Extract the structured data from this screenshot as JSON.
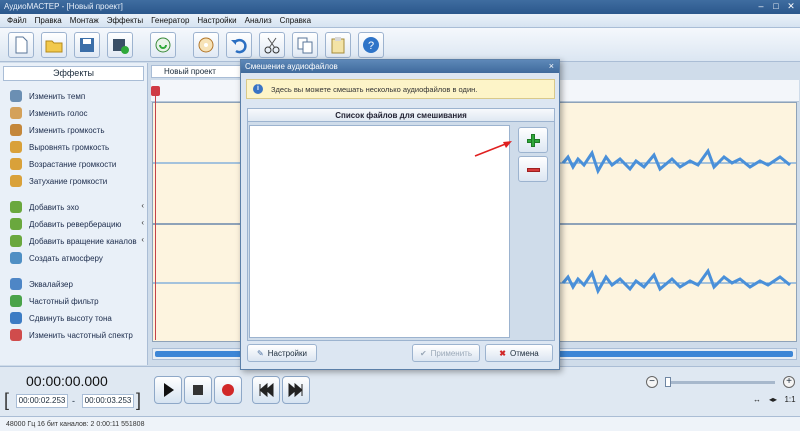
{
  "window": {
    "title": "АудиоМАСТЕР - [Новый проект]"
  },
  "menu": [
    "Файл",
    "Правка",
    "Монтаж",
    "Эффекты",
    "Генератор",
    "Настройки",
    "Анализ",
    "Справка"
  ],
  "toolbar_icons": [
    "new-file-icon",
    "open-folder-icon",
    "save-icon",
    "add-video-icon",
    "record-icon",
    "audio-cd-icon",
    "undo-icon",
    "cut-icon",
    "copy-icon",
    "paste-icon",
    "help-icon"
  ],
  "effects": {
    "title": "Эффекты",
    "items": [
      "Изменить темп",
      "Изменить голос",
      "Изменить громкость",
      "Выровнять громкость",
      "Возрастание громкости",
      "Затухание громкости",
      "Добавить эхо",
      "Добавить реверберацию",
      "Добавить вращение каналов",
      "Создать атмосферу",
      "Эквалайзер",
      "Частотный фильтр",
      "Сдвинуть высоту тона",
      "Изменить частотный спектр"
    ]
  },
  "document_tab": "Новый проект",
  "transport": {
    "current_time": "00:00:00.000",
    "selection_start": "00:00:02.253",
    "selection_end": "00:00:03.253",
    "separator": "-"
  },
  "zoom": {
    "minus": "−",
    "plus": "+",
    "fit_label": "1:1"
  },
  "status": "48000 Гц  16 бит  каналов: 2   0:00:11  551808",
  "dialog": {
    "title": "Смешение аудиофайлов",
    "close": "×",
    "info": "Здесь вы можете смешать несколько аудиофайлов в один.",
    "list_header": "Список файлов для смешивания",
    "settings_button": "Настройки",
    "apply_button": "Применить",
    "cancel_button": "Отмена"
  },
  "colors": {
    "accent": "#3d86d6",
    "waveform": "#4a90d9",
    "add_green": "#2fa93a",
    "remove_red": "#d63a3a",
    "annotation_arrow": "#e02020"
  }
}
